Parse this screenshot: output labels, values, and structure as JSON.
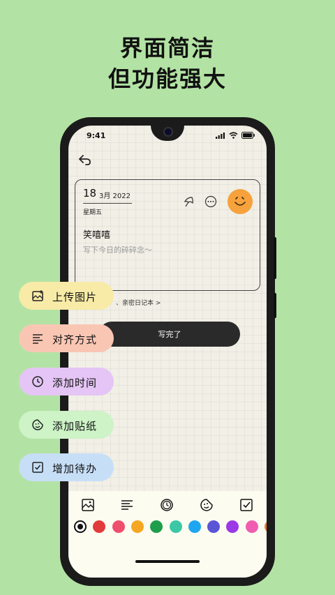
{
  "headline": {
    "line1": "界面简洁",
    "line2": "但功能强大"
  },
  "status": {
    "time": "9:41"
  },
  "note": {
    "day": "18",
    "month_year": "3月 2022",
    "weekday": "星期五",
    "title": "笑嘻嘻",
    "placeholder": "写下今日的碎碎念～"
  },
  "diary_link": "、亲密日记本 >",
  "done_button": "写完了",
  "feature_pills": [
    {
      "label": "上传图片",
      "icon": "image-upload-icon",
      "color": "#f7eba7"
    },
    {
      "label": "对齐方式",
      "icon": "align-left-icon",
      "color": "#fac6b4"
    },
    {
      "label": "添加时间",
      "icon": "clock-icon",
      "color": "#e4c5f5"
    },
    {
      "label": "添加贴纸",
      "icon": "sticker-icon",
      "color": "#cdf3c7"
    },
    {
      "label": "增加待办",
      "icon": "checkbox-icon",
      "color": "#c7def7"
    }
  ],
  "toolbar_icons": [
    "image-icon",
    "align-icon",
    "clock-icon",
    "sticker-icon",
    "checkbox-icon"
  ],
  "palette": [
    "#111111",
    "#e23b3b",
    "#ef4f6c",
    "#f5a623",
    "#1e9e4a",
    "#3cc7a6",
    "#1ea7f0",
    "#5a56d6",
    "#9b39e6",
    "#f05db0",
    "#f07a2a"
  ]
}
